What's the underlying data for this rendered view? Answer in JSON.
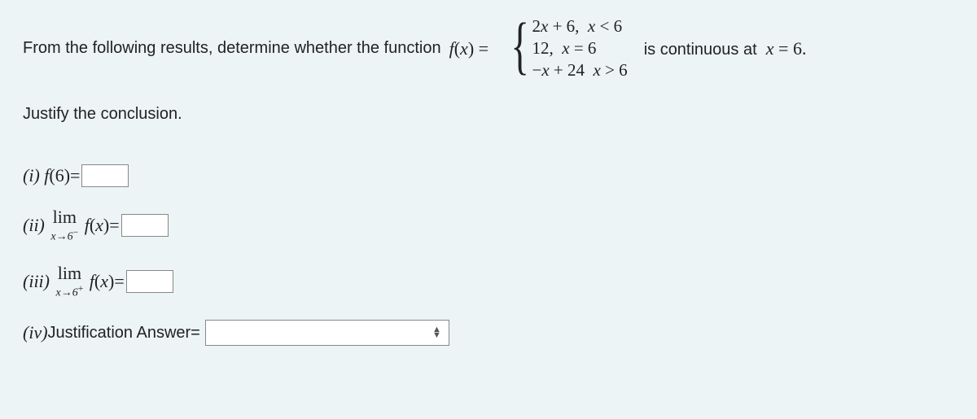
{
  "prompt": {
    "prefix": "From the following results, determine whether the function  ",
    "func_label": "f(x) = ",
    "cases": [
      "2x + 6,  x < 6",
      "12,  x = 6",
      "−x + 24  x > 6"
    ],
    "suffix": "is continuous at  x = 6."
  },
  "justify": "Justify the conclusion.",
  "parts": {
    "i": {
      "roman": "(i)",
      "label": " f(6)=",
      "value": ""
    },
    "ii": {
      "roman": "(ii)",
      "lim_top": "lim",
      "lim_bottom": "x→6−",
      "after": " f(x)=",
      "value": ""
    },
    "iii": {
      "roman": "(iii)",
      "lim_top": "lim",
      "lim_bottom": "x→6+",
      "after": " f(x)=",
      "value": ""
    },
    "iv": {
      "roman": "(iv)",
      "label": " Justification Answer=",
      "value": ""
    }
  }
}
